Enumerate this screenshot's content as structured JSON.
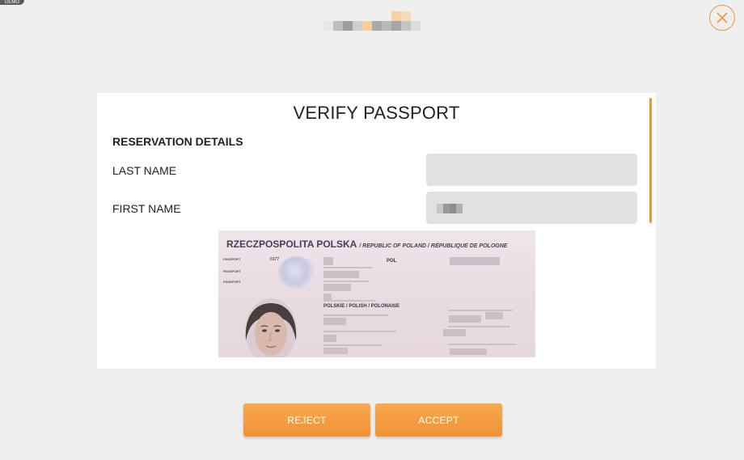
{
  "app": {
    "demo_badge": "DEMO",
    "close_icon": "close-icon",
    "accent": "#f0953c"
  },
  "dialog": {
    "title": "VERIFY PASSPORT",
    "section_title": "RESERVATION DETAILS",
    "fields": [
      {
        "label": "LAST NAME",
        "value": ""
      },
      {
        "label": "FIRST NAME",
        "value": ""
      }
    ],
    "passport_image": {
      "header": "RZECZPOSPOLITA POLSKA",
      "header_sub": "/ REPUBLIC OF POLAND / RÉPUBLIQUE DE POLOGNE",
      "labels": [
        "PASZPORT",
        "PASSPORT",
        "PASSPORT"
      ],
      "code": "POL",
      "nationality": "POLSKIE / POLISH / POLONAISE",
      "number_prefix": "0177"
    }
  },
  "actions": {
    "reject_label": "REJECT",
    "accept_label": "ACCEPT"
  }
}
